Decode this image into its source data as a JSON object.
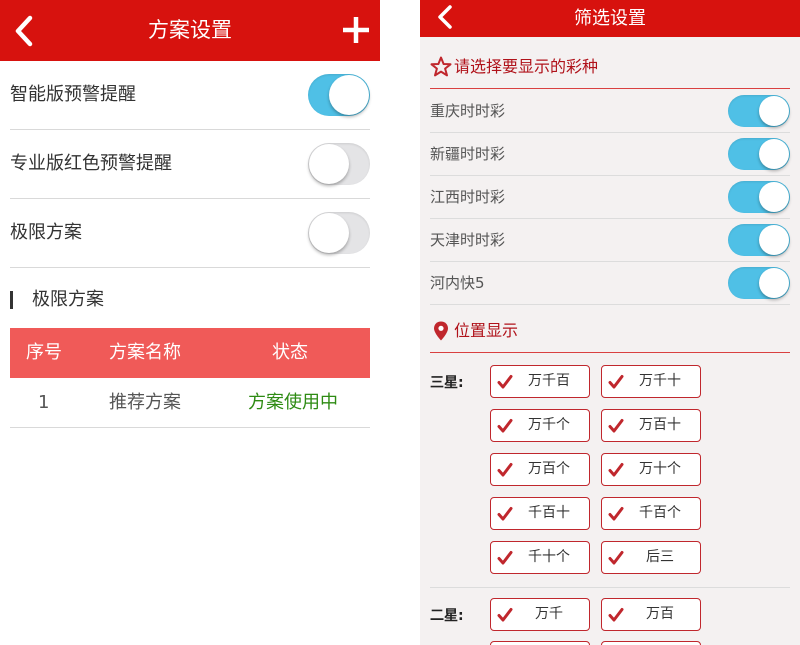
{
  "left": {
    "header": {
      "title": "方案设置"
    },
    "settings": [
      {
        "label": "智能版预警提醒",
        "on": true
      },
      {
        "label": "专业版红色预警提醒",
        "on": false
      },
      {
        "label": "极限方案",
        "on": false
      }
    ],
    "section_title": "极限方案",
    "table": {
      "headers": [
        "序号",
        "方案名称",
        "状态"
      ],
      "rows": [
        {
          "index": "1",
          "name": "推荐方案",
          "status": "方案使用中"
        }
      ]
    }
  },
  "right": {
    "header": {
      "title": "筛选设置"
    },
    "lottery_section_title": "请选择要显示的彩种",
    "lotteries": [
      {
        "label": "重庆时时彩",
        "on": true
      },
      {
        "label": "新疆时时彩",
        "on": true
      },
      {
        "label": "江西时时彩",
        "on": true
      },
      {
        "label": "天津时时彩",
        "on": true
      },
      {
        "label": "河内快5",
        "on": true
      }
    ],
    "position_section_title": "位置显示",
    "groups": [
      {
        "label": "三星:",
        "options": [
          "万千百",
          "万千十",
          "万千个",
          "万百十",
          "万百个",
          "万十个",
          "千百十",
          "千百个",
          "千十个",
          "后三"
        ]
      },
      {
        "label": "二星:",
        "options": [
          "万千",
          "万百"
        ]
      }
    ]
  },
  "colors": {
    "header_red": "#d7120e",
    "table_header": "#f05a58",
    "toggle_on": "#4fc0e6",
    "status_green": "#2e8b13",
    "section_red": "#b0121a"
  },
  "icons": [
    "back-arrow",
    "plus",
    "star-outline",
    "map-pin",
    "checkmark"
  ]
}
